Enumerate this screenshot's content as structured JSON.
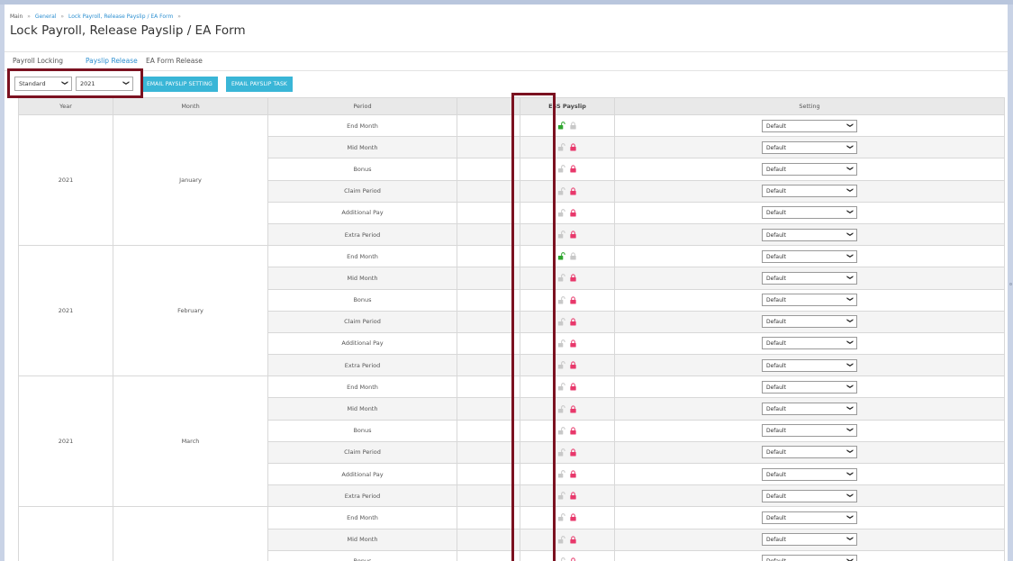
{
  "breadcrumb": [
    "Main",
    "General",
    "Lock Payroll, Release Payslip / EA Form"
  ],
  "title": "Lock Payroll, Release Payslip / EA Form",
  "tabs": [
    {
      "label": "Payroll Locking",
      "active": false
    },
    {
      "label": "Payslip Release",
      "active": true
    },
    {
      "label": "EA Form Release",
      "active": false
    }
  ],
  "controls": {
    "type_select": "Standard",
    "year_select": "2021",
    "email_setting_button": "EMAIL PAYSLIP SETTING",
    "email_task_button": "EMAIL PAYSLIP TASK"
  },
  "table": {
    "headers": [
      "Year",
      "Month",
      "Period",
      "",
      "ESS Payslip",
      "Setting"
    ],
    "groups": [
      {
        "year": "2021",
        "month": "January"
      },
      {
        "year": "2021",
        "month": "February"
      },
      {
        "year": "2021",
        "month": "March"
      },
      {
        "year": "",
        "month": ""
      }
    ],
    "rows": [
      {
        "period": "End Month",
        "status": "unlocked",
        "setting": "Default"
      },
      {
        "period": "Mid Month",
        "status": "locked",
        "setting": "Default"
      },
      {
        "period": "Bonus",
        "status": "locked",
        "setting": "Default"
      },
      {
        "period": "Claim Period",
        "status": "locked",
        "setting": "Default"
      },
      {
        "period": "Additional Pay",
        "status": "locked",
        "setting": "Default"
      },
      {
        "period": "Extra Period",
        "status": "locked",
        "setting": "Default"
      },
      {
        "period": "End Month",
        "status": "unlocked",
        "setting": "Default"
      },
      {
        "period": "Mid Month",
        "status": "locked",
        "setting": "Default"
      },
      {
        "period": "Bonus",
        "status": "locked",
        "setting": "Default"
      },
      {
        "period": "Claim Period",
        "status": "locked",
        "setting": "Default"
      },
      {
        "period": "Additional Pay",
        "status": "locked",
        "setting": "Default"
      },
      {
        "period": "Extra Period",
        "status": "locked",
        "setting": "Default"
      },
      {
        "period": "End Month",
        "status": "locked",
        "setting": "Default"
      },
      {
        "period": "Mid Month",
        "status": "locked",
        "setting": "Default"
      },
      {
        "period": "Bonus",
        "status": "locked",
        "setting": "Default"
      },
      {
        "period": "Claim Period",
        "status": "locked",
        "setting": "Default"
      },
      {
        "period": "Additional Pay",
        "status": "locked",
        "setting": "Default"
      },
      {
        "period": "Extra Period",
        "status": "locked",
        "setting": "Default"
      },
      {
        "period": "End Month",
        "status": "locked",
        "setting": "Default"
      },
      {
        "period": "Mid Month",
        "status": "locked",
        "setting": "Default"
      },
      {
        "period": "Bonus",
        "status": "locked",
        "setting": "Default"
      }
    ]
  },
  "colors": {
    "accent": "#2c8fd1",
    "button": "#3ab6d7",
    "highlight_box": "#7b1120",
    "unlocked_active": "#2fa52f",
    "locked_active": "#e8386b",
    "inactive_lock": "#c8c8c8"
  }
}
